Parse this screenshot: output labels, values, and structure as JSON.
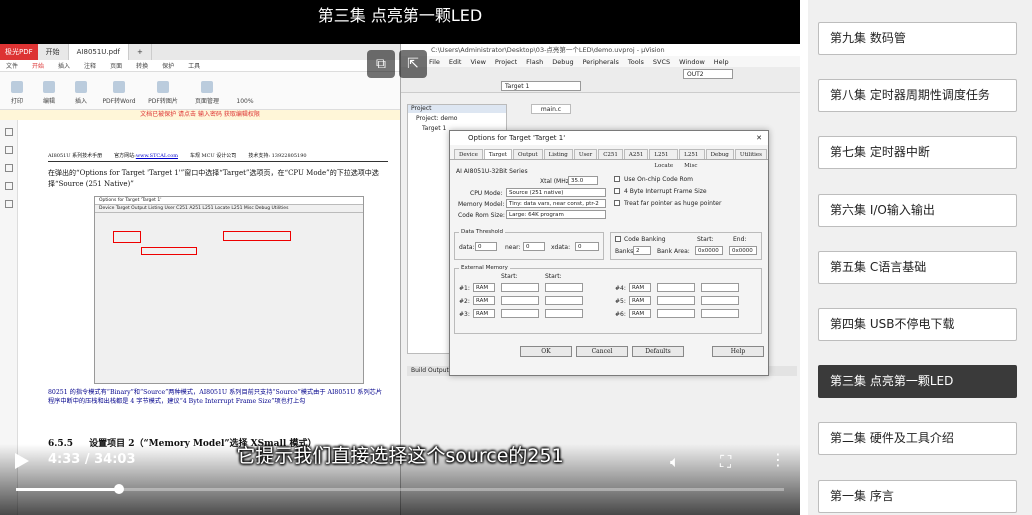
{
  "video": {
    "title": "第三集 点亮第一颗LED",
    "subtitle": "它提示我们直接选择这个source的251",
    "time_display": "4:33 / 34:03",
    "progress_fraction": 0.1336
  },
  "pdf": {
    "app_name": "极光PDF",
    "tabs": [
      "开始",
      "AI8051U.pdf",
      "+"
    ],
    "menu": [
      "文件",
      "开始",
      "插入",
      "注释",
      "页面",
      "转换",
      "保护",
      "工具"
    ],
    "ribbon": [
      "打印",
      "编辑",
      "插入",
      "PDF转Word",
      "PDF转图片",
      "页面管理"
    ],
    "zoom": "100%",
    "notice": "文档已被保护 请点击 输入密码 获取编辑权限",
    "header": [
      "AI8051U 系列技术手册",
      "官方网站:",
      "www.STCAI.com",
      "车规 MCU 设计公司",
      "技术支持: 13922805190"
    ],
    "para1": "在弹出的“Options for Target 'Target 1'”窗口中选择“Target”选项页，在“CPU Mode”的下拉选项中选择“Source (251 Native)”",
    "fig_title": "Options for Target 'Target 1'",
    "para2": "80251 的指令模式有“Binary”和“Source”两种模式，AI8051U 系列目前只支持“Source”模式由于 AI8051U 系列芯片程序中断中的压栈和出栈都是 4 字节模式，建议“4 Byte Interrupt Frame Size”项也打上勾",
    "section_num": "6.5.5",
    "section_title": "设置项目 2（“Memory Model”选择 XSmall 模式）"
  },
  "ide": {
    "title": "C:\\Users\\Administrator\\Desktop\\03-点亮第一个LED\\demo.uvproj - µVision",
    "menu": [
      "File",
      "Edit",
      "View",
      "Project",
      "Flash",
      "Debug",
      "Peripherals",
      "Tools",
      "SVCS",
      "Window",
      "Help"
    ],
    "target": "Target 1",
    "output": "OUT2",
    "project_header": "Project",
    "project_items": [
      "Project: demo",
      "Target 1"
    ],
    "editor_tab": "main.c",
    "build_output": "Build Output",
    "dialog": {
      "title": "Options for Target 'Target 1'",
      "tabs": [
        "Device",
        "Target",
        "Output",
        "Listing",
        "User",
        "C251",
        "A251",
        "L251 Locate",
        "L251 Misc",
        "Debug",
        "Utilities"
      ],
      "device": "AI AI8051U-32Bit Series",
      "xtal_label": "Xtal (MHz):",
      "xtal_value": "35.0",
      "cpu_mode_label": "CPU Mode:",
      "cpu_mode_value": "Source (251 native)",
      "memory_model_label": "Memory Model:",
      "memory_model_value": "Tiny: data vars, near const, ptr-2",
      "code_rom_label": "Code Rom Size:",
      "code_rom_value": "Large: 64K program",
      "chk_onchip": "Use On-chip Code Rom",
      "chk_4byte": "4 Byte Interrupt Frame Size",
      "chk_far": "Treat far pointer as huge pointer",
      "data_threshold": "Data Threshold",
      "data_label": "data:",
      "data_value": "0",
      "near_label": "near:",
      "near_value": "0",
      "xdata_label": "xdata:",
      "xdata_value": "0",
      "code_banking": "Code Banking",
      "start_label": "Start:",
      "end_label": "End:",
      "banks_label": "Banks:",
      "banks_value": "2",
      "bank_area_label": "Bank Area:",
      "bank_start": "0x0000",
      "bank_end": "0x0000",
      "external_memory": "External Memory",
      "mem_rows_left": [
        "#1:",
        "#2:",
        "#3:"
      ],
      "mem_rows_right": [
        "#4:",
        "#5:",
        "#6:"
      ],
      "ram_value": "RAM",
      "ok": "OK",
      "cancel": "Cancel",
      "defaults": "Defaults",
      "help": "Help"
    }
  },
  "episodes": [
    {
      "label": "第九集 数码管",
      "active": false
    },
    {
      "label": "第八集 定时器周期性调度任务",
      "active": false
    },
    {
      "label": "第七集 定时器中断",
      "active": false
    },
    {
      "label": "第六集 I/O输入输出",
      "active": false
    },
    {
      "label": "第五集 C语言基础",
      "active": false
    },
    {
      "label": "第四集 USB不停电下载",
      "active": false
    },
    {
      "label": "第三集 点亮第一颗LED",
      "active": true
    },
    {
      "label": "第二集 硬件及工具介绍",
      "active": false
    },
    {
      "label": "第一集 序言",
      "active": false
    }
  ],
  "icons": {
    "pip": "picture-in-picture-icon",
    "popout": "popout-icon",
    "play": "play-icon",
    "volume": "volume-icon",
    "fullscreen": "fullscreen-icon",
    "more": "more-icon"
  },
  "colors": {
    "active_episode_bg": "#3a3a3a",
    "highlight_box": "#ee0000",
    "pdf_accent": "#dd3333"
  }
}
